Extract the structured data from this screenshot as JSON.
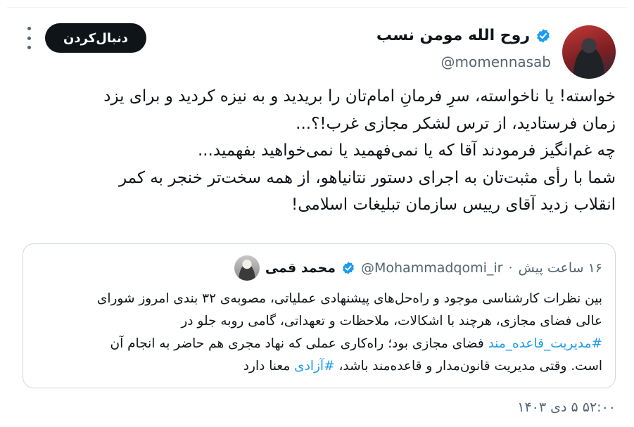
{
  "author": {
    "name": "روح الله مومن نسب",
    "handle": "@momennasab",
    "verified_color": "#1d9bf0"
  },
  "actions": {
    "follow_label": "دنبال‌کردن",
    "more_icon": "more-vertical-icon"
  },
  "tweet": {
    "lines": [
      "خواسته! یا ناخواسته، سرِ فرمانِ امام‌تان را بریدید و به نیزه کردید و برای یزد",
      "زمان فرستادید، از ترس لشکر مجازی غرب!؟...",
      "چه غم‌انگیز فرمودند آقا که یا نمی‌فهمید یا نمی‌خواهید بفهمید...",
      "شما با رأی مثبت‌تان به اجرای دستور نتانیاهو، از همه سخت‌تر خنجر به کمر",
      "انقلاب زدید آقای رییس سازمان تبلیغات اسلامی!"
    ],
    "timestamp": "۵۲:۰۰ ۵ دی ۱۴۰۳"
  },
  "quoted": {
    "name": "محمد قمی",
    "handle": "@Mohammadqomi_ir",
    "separator": "·",
    "time": "۱۶ ساعت پیش",
    "line1": "بین نظرات کارشناسی موجود و راه‌حل‌های پیشنهادی عملیاتی، مصوبه‌ی ۳۲ بندی امروز شورای",
    "line2": "عالی فضای مجازی، هرچند با اشکالات، ملاحظات و تعهداتی، گامی روبه جلو در",
    "line3_hashtag": "#مدیریت_قاعده_مند",
    "line3_text": " فضای مجازی بود؛ راه‌کاری عملی که نهاد مجری هم حاضر به انجام آن",
    "line4_text1": "است. وقتی مدیریت قانون‌مدار و قاعده‌مند باشد، ",
    "line4_hashtag": "#آزادی",
    "line4_text2": " معنا دارد"
  }
}
